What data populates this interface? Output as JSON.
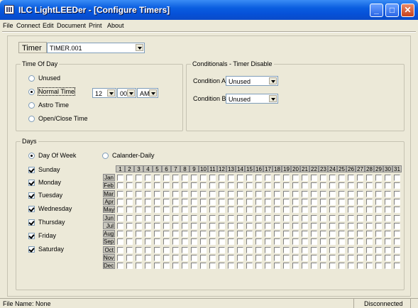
{
  "window": {
    "title": "ILC LightLEEDer - [Configure Timers]"
  },
  "menu": [
    "File",
    "Connect",
    "Edit",
    "Document",
    "Print",
    "About"
  ],
  "timer": {
    "label": "Timer",
    "value": "TIMER.001"
  },
  "time_of_day": {
    "title": "Time Of Day",
    "options": [
      "Unused",
      "Normal Time",
      "Astro Time",
      "Open/Close Time"
    ],
    "selected": "Normal Time",
    "hour": "12",
    "minute": "00",
    "ampm": "AM"
  },
  "conditionals": {
    "title": "Conditionals - Timer Disable",
    "a_label": "Condition A",
    "a_value": "Unused",
    "b_label": "Condition B",
    "b_value": "Unused"
  },
  "days": {
    "title": "Days",
    "mode_week": "Day Of Week",
    "mode_calendar": "Calander-Daily",
    "selected_mode": "Day Of Week",
    "weekdays": [
      {
        "label": "Sunday",
        "checked": true
      },
      {
        "label": "Monday",
        "checked": true
      },
      {
        "label": "Tuesday",
        "checked": true
      },
      {
        "label": "Wednesday",
        "checked": true
      },
      {
        "label": "Thursday",
        "checked": true
      },
      {
        "label": "Friday",
        "checked": true
      },
      {
        "label": "Saturday",
        "checked": true
      }
    ],
    "months": [
      "Jan",
      "Feb",
      "Mar",
      "Apr",
      "May",
      "Jun",
      "Jul",
      "Aug",
      "Sep",
      "Oct",
      "Nov",
      "Dec"
    ],
    "day_numbers": [
      "1",
      "2",
      "3",
      "4",
      "5",
      "6",
      "7",
      "8",
      "9",
      "10",
      "11",
      "12",
      "13",
      "14",
      "15",
      "16",
      "17",
      "18",
      "19",
      "20",
      "21",
      "22",
      "23",
      "24",
      "25",
      "26",
      "27",
      "28",
      "29",
      "30",
      "31"
    ]
  },
  "status": {
    "file": "File Name: None",
    "connection": "Disconnected"
  }
}
